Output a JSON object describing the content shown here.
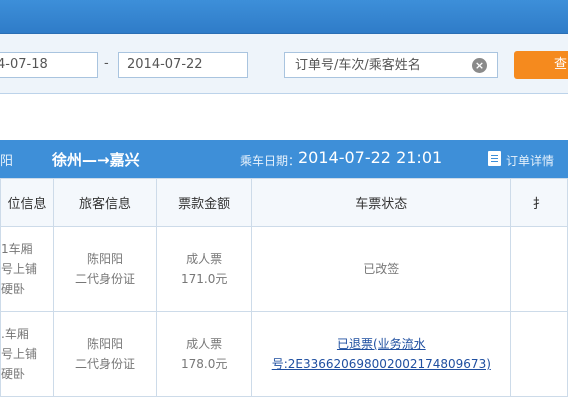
{
  "filter": {
    "date_from": "4-07-18",
    "date_separator": "-",
    "date_to": "2014-07-22",
    "search_placeholder": "订单号/车次/乘客姓名",
    "clear_icon": "clear-circle-icon",
    "query_label": "查"
  },
  "order": {
    "left_partial": "阳",
    "route": "徐州—→嘉兴",
    "date_label": "乘车日期：",
    "date_value": "2014-07-22 21:01",
    "detail_icon": "document-icon",
    "detail_label": "订单详情"
  },
  "table": {
    "headers": [
      "位信息",
      "旅客信息",
      "票款金额",
      "车票状态",
      "扌"
    ],
    "rows": [
      {
        "seat": [
          "1车厢",
          "号上铺",
          "硬卧"
        ],
        "passenger": [
          "陈阳阳",
          "二代身份证"
        ],
        "fare": [
          "成人票",
          "171.0元"
        ],
        "status": [
          "已改签"
        ]
      },
      {
        "seat": [
          ".车厢",
          "号上铺",
          "硬卧"
        ],
        "passenger": [
          "陈阳阳",
          "二代身份证"
        ],
        "fare": [
          "成人票",
          "178.0元"
        ],
        "status": [
          "已退票(业务流水",
          "号:2E336620698002002174809673)"
        ]
      }
    ]
  }
}
